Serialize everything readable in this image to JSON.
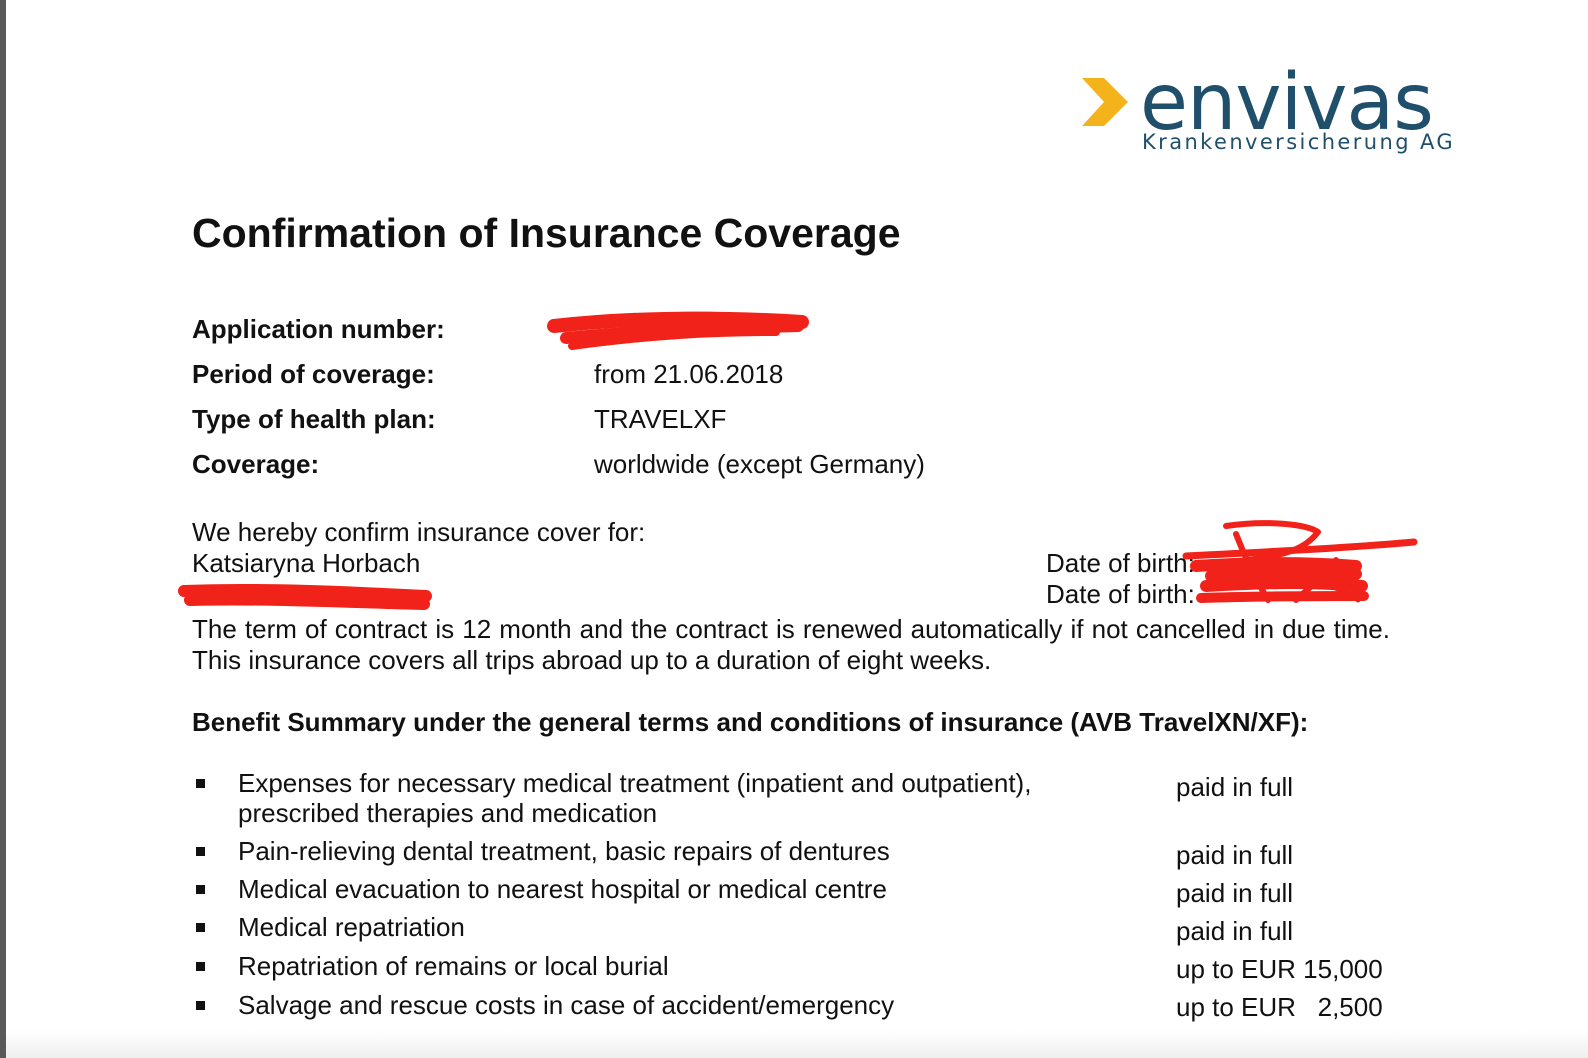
{
  "logo": {
    "wordmark": "envivas",
    "subtitle": "Krankenversicherung AG",
    "colors": {
      "arrow": "#f5b31b",
      "text": "#1f4f6b"
    }
  },
  "title": "Confirmation of Insurance Coverage",
  "fields": [
    {
      "label": "Application number:",
      "value": ""
    },
    {
      "label": "Period of coverage:",
      "value": "from 21.06.2018"
    },
    {
      "label": "Type of health plan:",
      "value": "TRAVELXF"
    },
    {
      "label": "Coverage:",
      "value": "worldwide (except Germany)"
    }
  ],
  "insured": {
    "intro": "We hereby confirm insurance cover for:",
    "persons": [
      {
        "name": "Katsiaryna Horbach",
        "dob_label": "Date of birth:"
      },
      {
        "name": "",
        "dob_label": "Date of birth:"
      }
    ]
  },
  "contract_text": "The term of contract is 12 month and the contract is renewed automatically if not cancelled in due time. This insurance covers all trips abroad up to a duration of eight weeks.",
  "benefits": {
    "title": "Benefit Summary under the general terms and conditions of insurance (AVB TravelXN/XF):",
    "items": [
      {
        "line1": "Expenses for necessary medical treatment (inpatient and outpatient),",
        "line2": "prescribed therapies and medication",
        "amount": "paid in full"
      },
      {
        "line1": "Pain-relieving dental treatment, basic repairs of dentures",
        "line2": "",
        "amount": "paid in full"
      },
      {
        "line1": "Medical evacuation to nearest hospital or medical centre",
        "line2": "",
        "amount": "paid in full"
      },
      {
        "line1": "Medical repatriation",
        "line2": "",
        "amount": "paid in full"
      },
      {
        "line1": "Repatriation of remains or local burial",
        "line2": "",
        "amount": "up to EUR 15,000"
      },
      {
        "line1": "Salvage and rescue costs in case of accident/emergency",
        "line2": "",
        "amount": "up to EUR   2,500"
      }
    ]
  },
  "redaction_color": "#f0221a"
}
